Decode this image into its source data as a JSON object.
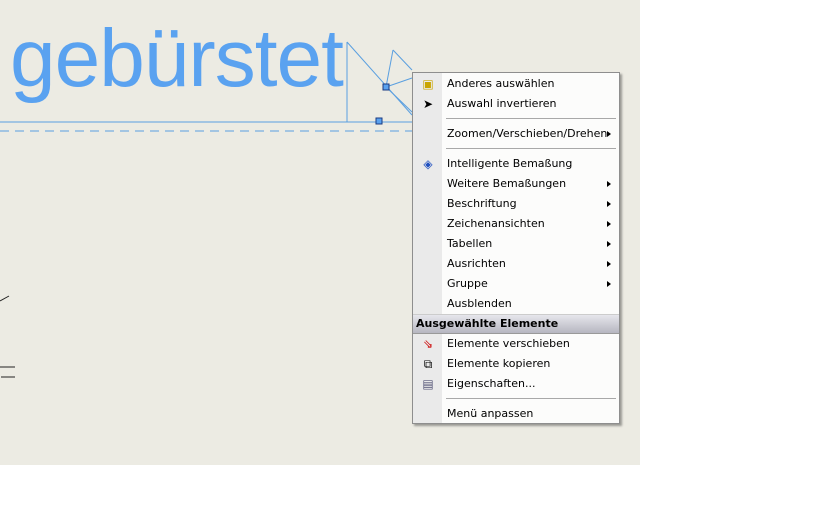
{
  "drawing": {
    "text": "gebürstet"
  },
  "menu": {
    "group1": [
      {
        "label": "Anderes auswählen",
        "icon": "select-other-icon"
      },
      {
        "label": "Auswahl invertieren",
        "icon": "invert-selection-icon"
      }
    ],
    "zoom": {
      "label": "Zoomen/Verschieben/Drehen"
    },
    "group2": [
      {
        "label": "Intelligente Bemaßung",
        "icon": "smart-dimension-icon",
        "submenu": false
      },
      {
        "label": "Weitere Bemaßungen",
        "submenu": true
      },
      {
        "label": "Beschriftung",
        "submenu": true
      },
      {
        "label": "Zeichenansichten",
        "submenu": true
      },
      {
        "label": "Tabellen",
        "submenu": true
      },
      {
        "label": "Ausrichten",
        "submenu": true
      },
      {
        "label": "Gruppe",
        "submenu": true
      },
      {
        "label": "Ausblenden",
        "submenu": false
      }
    ],
    "section_header": "Ausgewählte Elemente",
    "group3": [
      {
        "label": "Elemente verschieben",
        "icon": "move-entities-icon"
      },
      {
        "label": "Elemente kopieren",
        "icon": "copy-entities-icon"
      },
      {
        "label": "Eigenschaften...",
        "icon": "properties-icon"
      }
    ],
    "customize": "Menü anpassen"
  }
}
